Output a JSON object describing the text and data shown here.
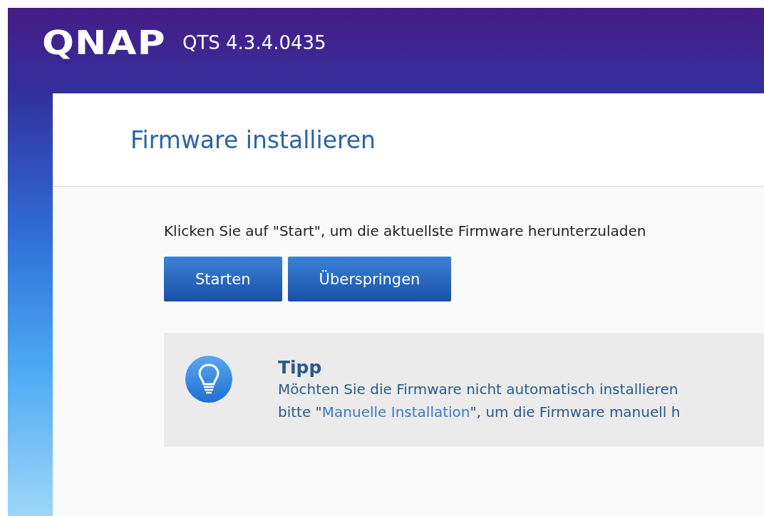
{
  "header": {
    "logo": "QNAP",
    "version": "QTS 4.3.4.0435"
  },
  "panel": {
    "title": "Firmware installieren",
    "instruction": "Klicken Sie auf \"Start\", um die aktuellste Firmware herunterzuladen",
    "buttons": [
      {
        "label": "Starten"
      },
      {
        "label": "Überspringen"
      }
    ],
    "tip": {
      "title": "Tipp",
      "lines": [
        {
          "parts": [
            {
              "text": "Möchten Sie die Firmware nicht automatisch installieren",
              "kind": "text"
            }
          ]
        },
        {
          "parts": [
            {
              "text": "bitte \"",
              "kind": "text"
            },
            {
              "text": "Manuelle Installation",
              "kind": "link"
            },
            {
              "text": "\", um die Firmware manuell h",
              "kind": "text"
            }
          ]
        }
      ]
    }
  }
}
